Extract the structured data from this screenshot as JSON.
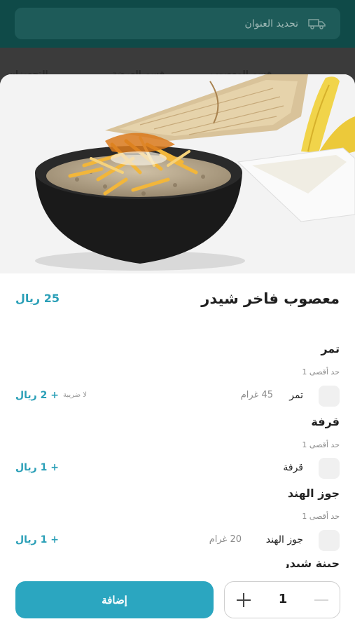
{
  "header": {
    "address_label": "تحديد العنوان",
    "address_icon": "truck-icon",
    "tabs": [
      "التجهيزات",
      "قسم العرضة",
      "قسم المعصوب"
    ]
  },
  "product": {
    "title": "معصوب فاخر شيدر",
    "price": "25 ريال"
  },
  "groups": [
    {
      "title": "تمر",
      "limit": "حد أقصى 1",
      "option": {
        "name": "تمر",
        "weight": "45 غرام",
        "tax": "لا ضريبة",
        "price": "+ 2 ريال"
      }
    },
    {
      "title": "قرفة",
      "limit": "حد أقصى 1",
      "option": {
        "name": "قرفة",
        "price": "+ 1 ريال"
      }
    },
    {
      "title": "جوز الهند",
      "limit": "حد أقصى 1",
      "option": {
        "name": "جوز الهند",
        "weight": "20 غرام",
        "price": "+ 1 ريال"
      }
    }
  ],
  "next_group_title": "جبنة شيدر",
  "actions": {
    "add_label": "إضافة",
    "quantity": "1"
  },
  "colors": {
    "header_bg": "#0f4a48",
    "accent": "#2ba6c0",
    "price": "#2a9fb7"
  }
}
